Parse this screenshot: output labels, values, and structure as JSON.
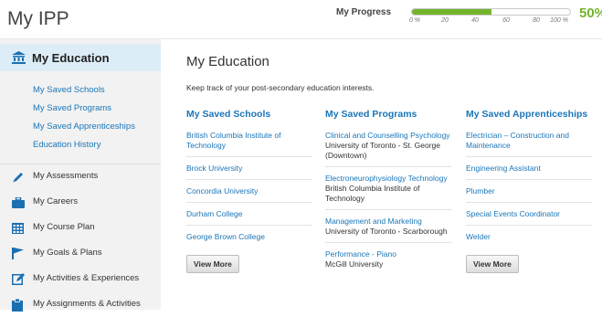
{
  "header": {
    "title": "My IPP",
    "progress_label": "My Progress",
    "progress_value": 0.5,
    "progress_ticks": [
      "0 %",
      "20",
      "40",
      "60",
      "80",
      "100 %"
    ],
    "progress_percent": "50%"
  },
  "sidebar": {
    "section_title": "My Education",
    "sub_items": [
      {
        "label": "My Saved Schools"
      },
      {
        "label": "My Saved Programs"
      },
      {
        "label": "My Saved Apprenticeships"
      },
      {
        "label": "Education History"
      }
    ],
    "nav_items": [
      {
        "label": "My Assessments",
        "icon": "pencil-icon"
      },
      {
        "label": "My Careers",
        "icon": "briefcase-icon"
      },
      {
        "label": "My Course Plan",
        "icon": "calendar-grid-icon"
      },
      {
        "label": "My Goals & Plans",
        "icon": "flag-icon"
      },
      {
        "label": "My Activities & Experiences",
        "icon": "edit-box-icon"
      },
      {
        "label": "My Assignments & Activities",
        "icon": "clipboard-icon"
      }
    ]
  },
  "main": {
    "title": "My Education",
    "intro": "Keep track of your post-secondary education interests.",
    "schools": {
      "heading": "My Saved Schools",
      "items": [
        {
          "name": "British Columbia Institute of Technology"
        },
        {
          "name": "Brock University"
        },
        {
          "name": "Concordia University"
        },
        {
          "name": "Durham College"
        },
        {
          "name": "George Brown College"
        }
      ],
      "view_more": "View More"
    },
    "programs": {
      "heading": "My Saved Programs",
      "items": [
        {
          "name": "Clinical and Counselling Psychology",
          "school": "University of Toronto - St. George (Downtown)"
        },
        {
          "name": "Electroneurophysiology Technology",
          "school": "British Columbia Institute of Technology"
        },
        {
          "name": "Management and Marketing",
          "school": "University of Toronto - Scarborough"
        },
        {
          "name": "Performance - Piano",
          "school": "McGill University"
        }
      ]
    },
    "apprenticeships": {
      "heading": "My Saved Apprenticeships",
      "items": [
        {
          "name": "Electrician – Construction and Maintenance"
        },
        {
          "name": "Engineering Assistant"
        },
        {
          "name": "Plumber"
        },
        {
          "name": "Special Events Coordinator"
        },
        {
          "name": "Welder"
        }
      ],
      "view_more": "View More"
    }
  },
  "colors": {
    "link": "#1a76b8",
    "progress": "#72b52b",
    "sidebar_active": "#dcedf7",
    "sidebar_bg": "#f2f2f2",
    "icon": "#1a6fb0"
  }
}
